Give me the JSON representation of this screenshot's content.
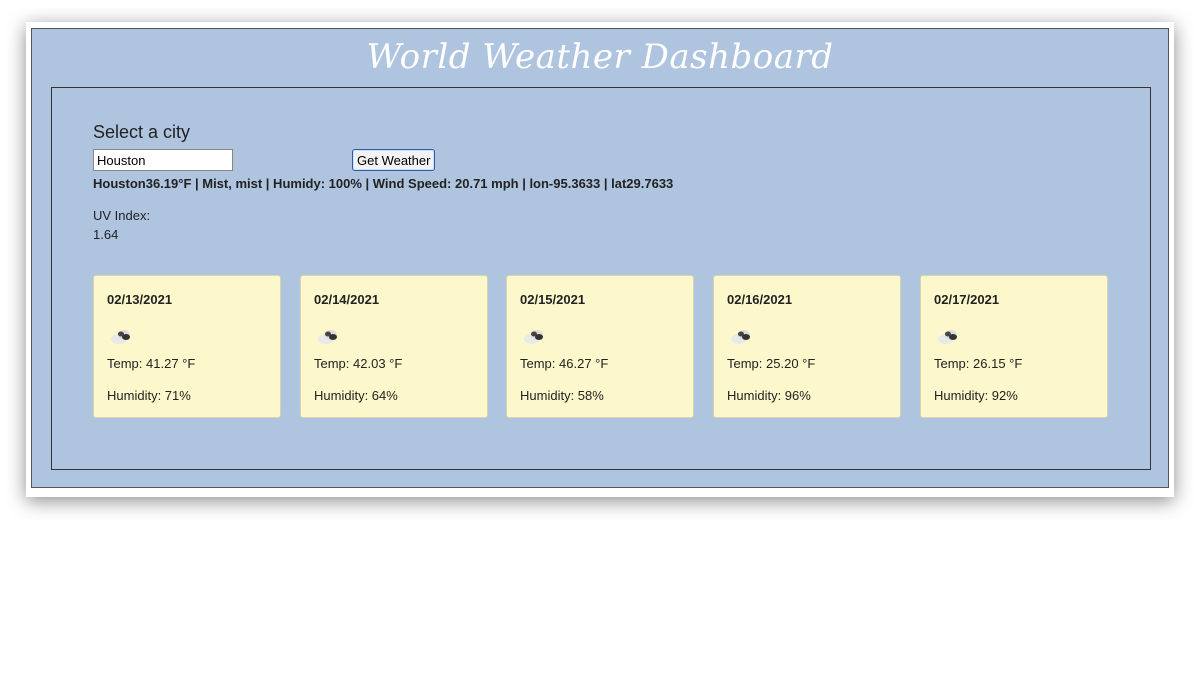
{
  "app": {
    "title": "World Weather Dashboard"
  },
  "search": {
    "label": "Select a city",
    "city_value": "Houston",
    "button_label": "Get Weather"
  },
  "current": {
    "summary": "Houston36.19°F | Mist, mist | Humidy: 100% | Wind Speed: 20.71 mph | lon-95.3633 | lat29.7633",
    "uv_label": "UV Index:",
    "uv_value": "1.64"
  },
  "forecast": [
    {
      "date": "02/13/2021",
      "icon": "cloud-icon",
      "temp": "Temp: 41.27 °F",
      "humidity": "Humidity: 71%"
    },
    {
      "date": "02/14/2021",
      "icon": "cloud-icon",
      "temp": "Temp: 42.03 °F",
      "humidity": "Humidity: 64%"
    },
    {
      "date": "02/15/2021",
      "icon": "cloud-icon",
      "temp": "Temp: 46.27 °F",
      "humidity": "Humidity: 58%"
    },
    {
      "date": "02/16/2021",
      "icon": "cloud-icon",
      "temp": "Temp: 25.20 °F",
      "humidity": "Humidity: 96%"
    },
    {
      "date": "02/17/2021",
      "icon": "cloud-icon",
      "temp": "Temp: 26.15 °F",
      "humidity": "Humidity: 92%"
    }
  ],
  "colors": {
    "background": "#afc4de",
    "card": "#fdf8cb",
    "title": "#ffffff"
  }
}
